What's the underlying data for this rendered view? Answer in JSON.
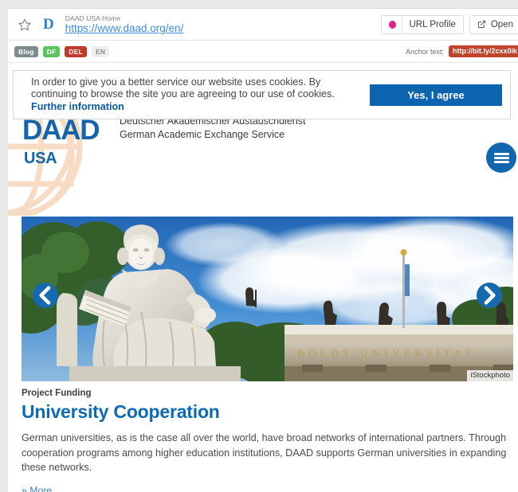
{
  "urlbar": {
    "star_icon": "star-icon",
    "favicon_letter": "D",
    "page_title": "DAAD USA Home",
    "url": "https://www.daad.org/en/",
    "url_profile_label": "URL Profile",
    "open_label": "Open",
    "profile_dot_color": "#e0218a"
  },
  "tagbar": {
    "tags": [
      {
        "label": "Blog",
        "color": "#7b8b8e"
      },
      {
        "label": "DF",
        "color": "#5cc45c"
      },
      {
        "label": "DEL",
        "color": "#c0392b"
      },
      {
        "label": "EN",
        "color": "#eeeeee"
      }
    ],
    "anchor_label": "Anchor text:",
    "anchor_value": "http://bit.ly/2cxx0ik",
    "anchor_color": "#c0442b"
  },
  "cookie": {
    "text": "In order to give you a better service our website uses cookies. By continuing to browse the site you are agreeing to our use of cookies. ",
    "link": "Further information",
    "button": "Yes, I agree",
    "button_color": "#0b64ad"
  },
  "site_header": {
    "logo": "DAAD",
    "country": "USA",
    "subtitle_de": "Deutscher Akademischer Austauschdienst",
    "subtitle_en": "German Academic Exchange Service",
    "menu_icon": "hamburger-icon",
    "brand_color": "#1464aa"
  },
  "hero": {
    "prev_icon": "chevron-left-icon",
    "next_icon": "chevron-right-icon",
    "credit": "iStockphoto",
    "building_inscription": "BOLDT  UNIVERSITAT"
  },
  "article": {
    "kicker": "Project Funding",
    "headline": "University Cooperation",
    "body": "German universities, as is the case all over the world, have broad networks of international partners. Through cooperation programs among higher education institutions, DAAD supports German universities in expanding these networks.",
    "more": "» More"
  }
}
